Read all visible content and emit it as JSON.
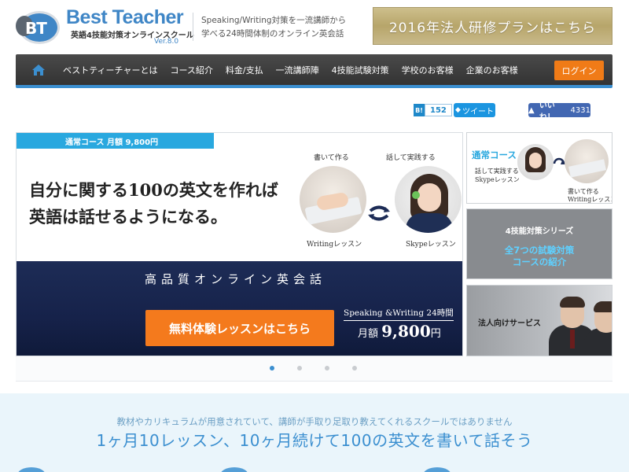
{
  "header": {
    "logo_badge": "BT",
    "logo_name": "Best Teacher",
    "logo_sub": "英語4技能対策オンラインスクール",
    "logo_version": "Ver.8.0",
    "tagline_line1": "Speaking/Writing対策を一流講師から",
    "tagline_line2": "学べる24時間体制のオンライン英会話",
    "promo_button": "2016年法人研修プランはこちら"
  },
  "nav": {
    "home_icon": "home-icon",
    "items": [
      {
        "label": "ベストティーチャーとは"
      },
      {
        "label": "コース紹介"
      },
      {
        "label": "料金/支払"
      },
      {
        "label": "一流講師陣"
      },
      {
        "label": "4技能試験対策"
      },
      {
        "label": "学校のお客様"
      },
      {
        "label": "企業のお客様"
      }
    ],
    "login": "ログイン"
  },
  "social": {
    "hatena_badge": "B!",
    "hatena_count": "152",
    "tweet": "ツイート",
    "like": "いいね！",
    "like_count": "4331"
  },
  "slider": {
    "tab": "通常コース  月額 9,800円",
    "headline_line1": "自分に関する100の英文を作れば",
    "headline_line2": "英語は話せるようになる。",
    "label_write_top": "書いて作る",
    "label_speak_top": "話して実践する",
    "label_writing": "Writingレッスン",
    "label_skype": "Skypeレッスン",
    "banner_subtitle": "高品質オンライン英会話",
    "cta": "無料体験レッスンはこちら",
    "price_line1_a": "Speaking",
    "price_line1_b": "&Writing",
    "price_line1_c": "24時間",
    "price_line2_a": "月額 ",
    "price_line2_b": "9,800",
    "price_line2_c": "円",
    "dots_count": 4,
    "active_dot": 0
  },
  "side_cards": {
    "card1_title": "通常コース",
    "card1_l1a": "話して実践する",
    "card1_l1b": "Skypeレッスン",
    "card1_l2a": "書いて作る",
    "card1_l2b": "Writingレッスン",
    "card2_t1": "4技能対策シリーズ",
    "card2_t2a": "全7つの試験対策",
    "card2_t2b": "コースの紹介",
    "card3_title": "法人向けサービス"
  },
  "bottom": {
    "small": "教材やカリキュラムが用意されていて、講師が手取り足取り教えてくれるスクールではありません",
    "big": "1ヶ月10レッスン、10ヶ月続けて100の英文を書いて話そう"
  },
  "colors": {
    "brand_blue": "#3b8fd0",
    "accent_orange": "#f47a1d",
    "gold": "#b7a56a",
    "nav_dark": "#3a3a3a"
  }
}
